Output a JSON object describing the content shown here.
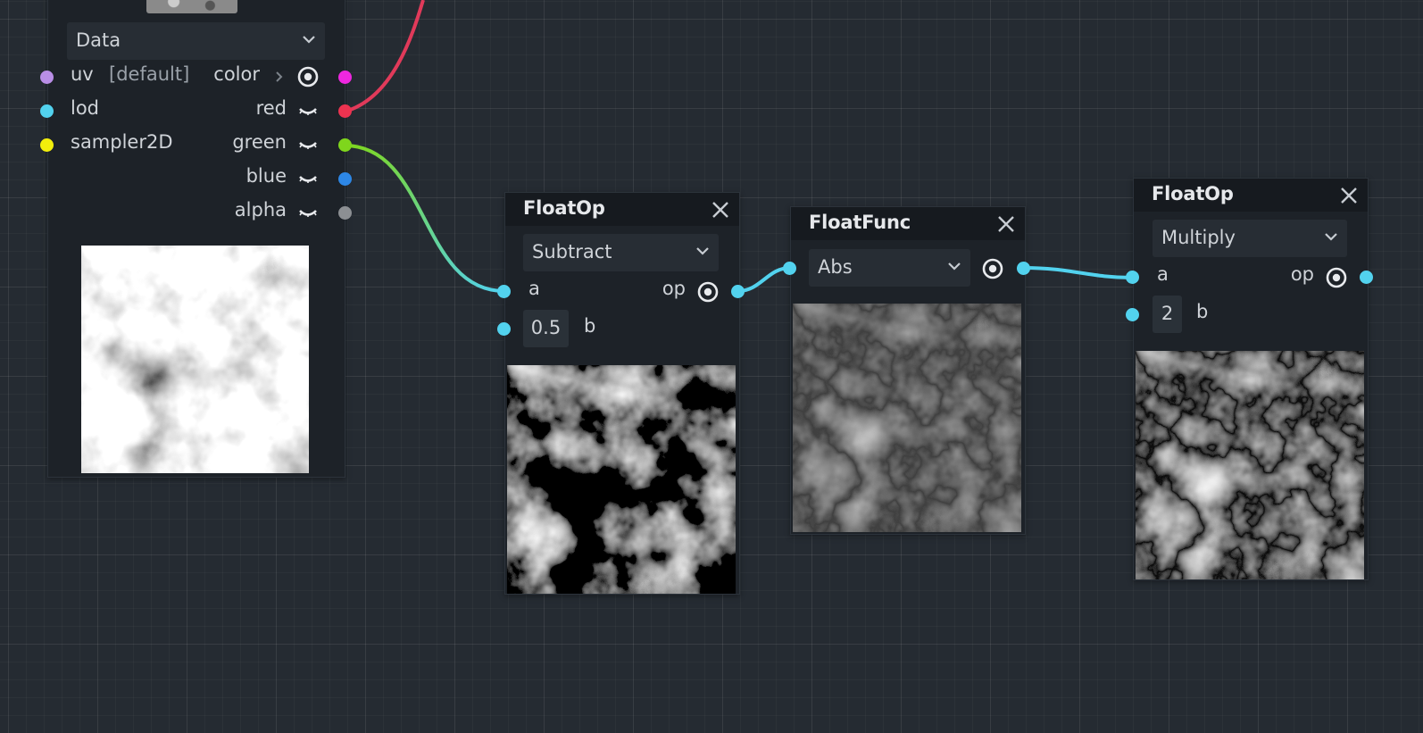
{
  "texture_node": {
    "mode_dropdown": "Data",
    "inputs": [
      {
        "label": "uv",
        "hint": "[default]",
        "color": "#b98ee6"
      },
      {
        "label": "lod",
        "color": "#52d2ee"
      },
      {
        "label": "sampler2D",
        "color": "#f2ee0c"
      }
    ],
    "outputs": [
      {
        "label": "color",
        "color": "#ef27e0"
      },
      {
        "label": "red",
        "color": "#ec3350"
      },
      {
        "label": "green",
        "color": "#7fd61c"
      },
      {
        "label": "blue",
        "color": "#2d87e6"
      },
      {
        "label": "alpha",
        "color": "#8c8f93"
      }
    ]
  },
  "floatop_subtract": {
    "title": "FloatOp",
    "operation": "Subtract",
    "input_a": "a",
    "input_b": "b",
    "value_b": "0.5",
    "output": "op"
  },
  "floatfunc_abs": {
    "title": "FloatFunc",
    "function": "Abs"
  },
  "floatop_multiply": {
    "title": "FloatOp",
    "operation": "Multiply",
    "input_a": "a",
    "input_b": "b",
    "value_b": "2",
    "output": "op"
  },
  "colors": {
    "float_wire": "#52d2ee",
    "red_wire": "#e13a5a",
    "green_wire": "#7fd61c"
  },
  "icons": [
    "eye-icon",
    "close-icon",
    "chevron-down-icon",
    "chevron-right-icon",
    "visibility-toggle-icon"
  ]
}
